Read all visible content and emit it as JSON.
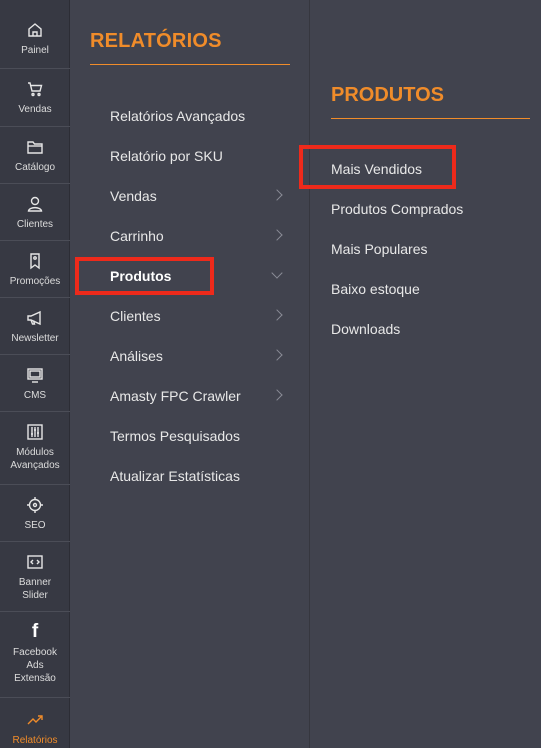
{
  "rail": {
    "items": [
      {
        "label": "Painel",
        "icon": "home-icon"
      },
      {
        "label": "Vendas",
        "icon": "cart-icon"
      },
      {
        "label": "Catálogo",
        "icon": "folder-icon"
      },
      {
        "label": "Clientes",
        "icon": "person-icon"
      },
      {
        "label": "Promoções",
        "icon": "tag-icon"
      },
      {
        "label": "Newsletter",
        "icon": "megaphone-icon"
      },
      {
        "label": "CMS",
        "icon": "monitor-icon"
      },
      {
        "label": "Módulos Avançados",
        "icon": "sliders-icon"
      },
      {
        "label": "SEO",
        "icon": "crosshair-icon"
      },
      {
        "label": "Banner Slider",
        "icon": "code-icon"
      },
      {
        "label": "Facebook Ads Extensão",
        "icon": "facebook-icon"
      },
      {
        "label": "Relatórios",
        "icon": "chart-line-icon"
      }
    ],
    "active": "Relatórios",
    "accent_color": "#f08c2a"
  },
  "reports": {
    "title": "RELATÓRIOS",
    "items": [
      {
        "label": "Relatórios Avançados",
        "has_submenu": false
      },
      {
        "label": "Relatório por SKU",
        "has_submenu": false
      },
      {
        "label": "Vendas",
        "has_submenu": true
      },
      {
        "label": "Carrinho",
        "has_submenu": true
      },
      {
        "label": "Produtos",
        "has_submenu": true,
        "expanded": true
      },
      {
        "label": "Clientes",
        "has_submenu": true
      },
      {
        "label": "Análises",
        "has_submenu": true
      },
      {
        "label": "Amasty FPC Crawler",
        "has_submenu": true
      },
      {
        "label": "Termos Pesquisados",
        "has_submenu": false
      },
      {
        "label": "Atualizar Estatísticas",
        "has_submenu": false
      }
    ]
  },
  "products": {
    "title": "PRODUTOS",
    "items": [
      {
        "label": "Mais Vendidos"
      },
      {
        "label": "Produtos Comprados"
      },
      {
        "label": "Mais Populares"
      },
      {
        "label": "Baixo estoque"
      },
      {
        "label": "Downloads"
      }
    ]
  },
  "highlight_color": "#ee2a1b"
}
